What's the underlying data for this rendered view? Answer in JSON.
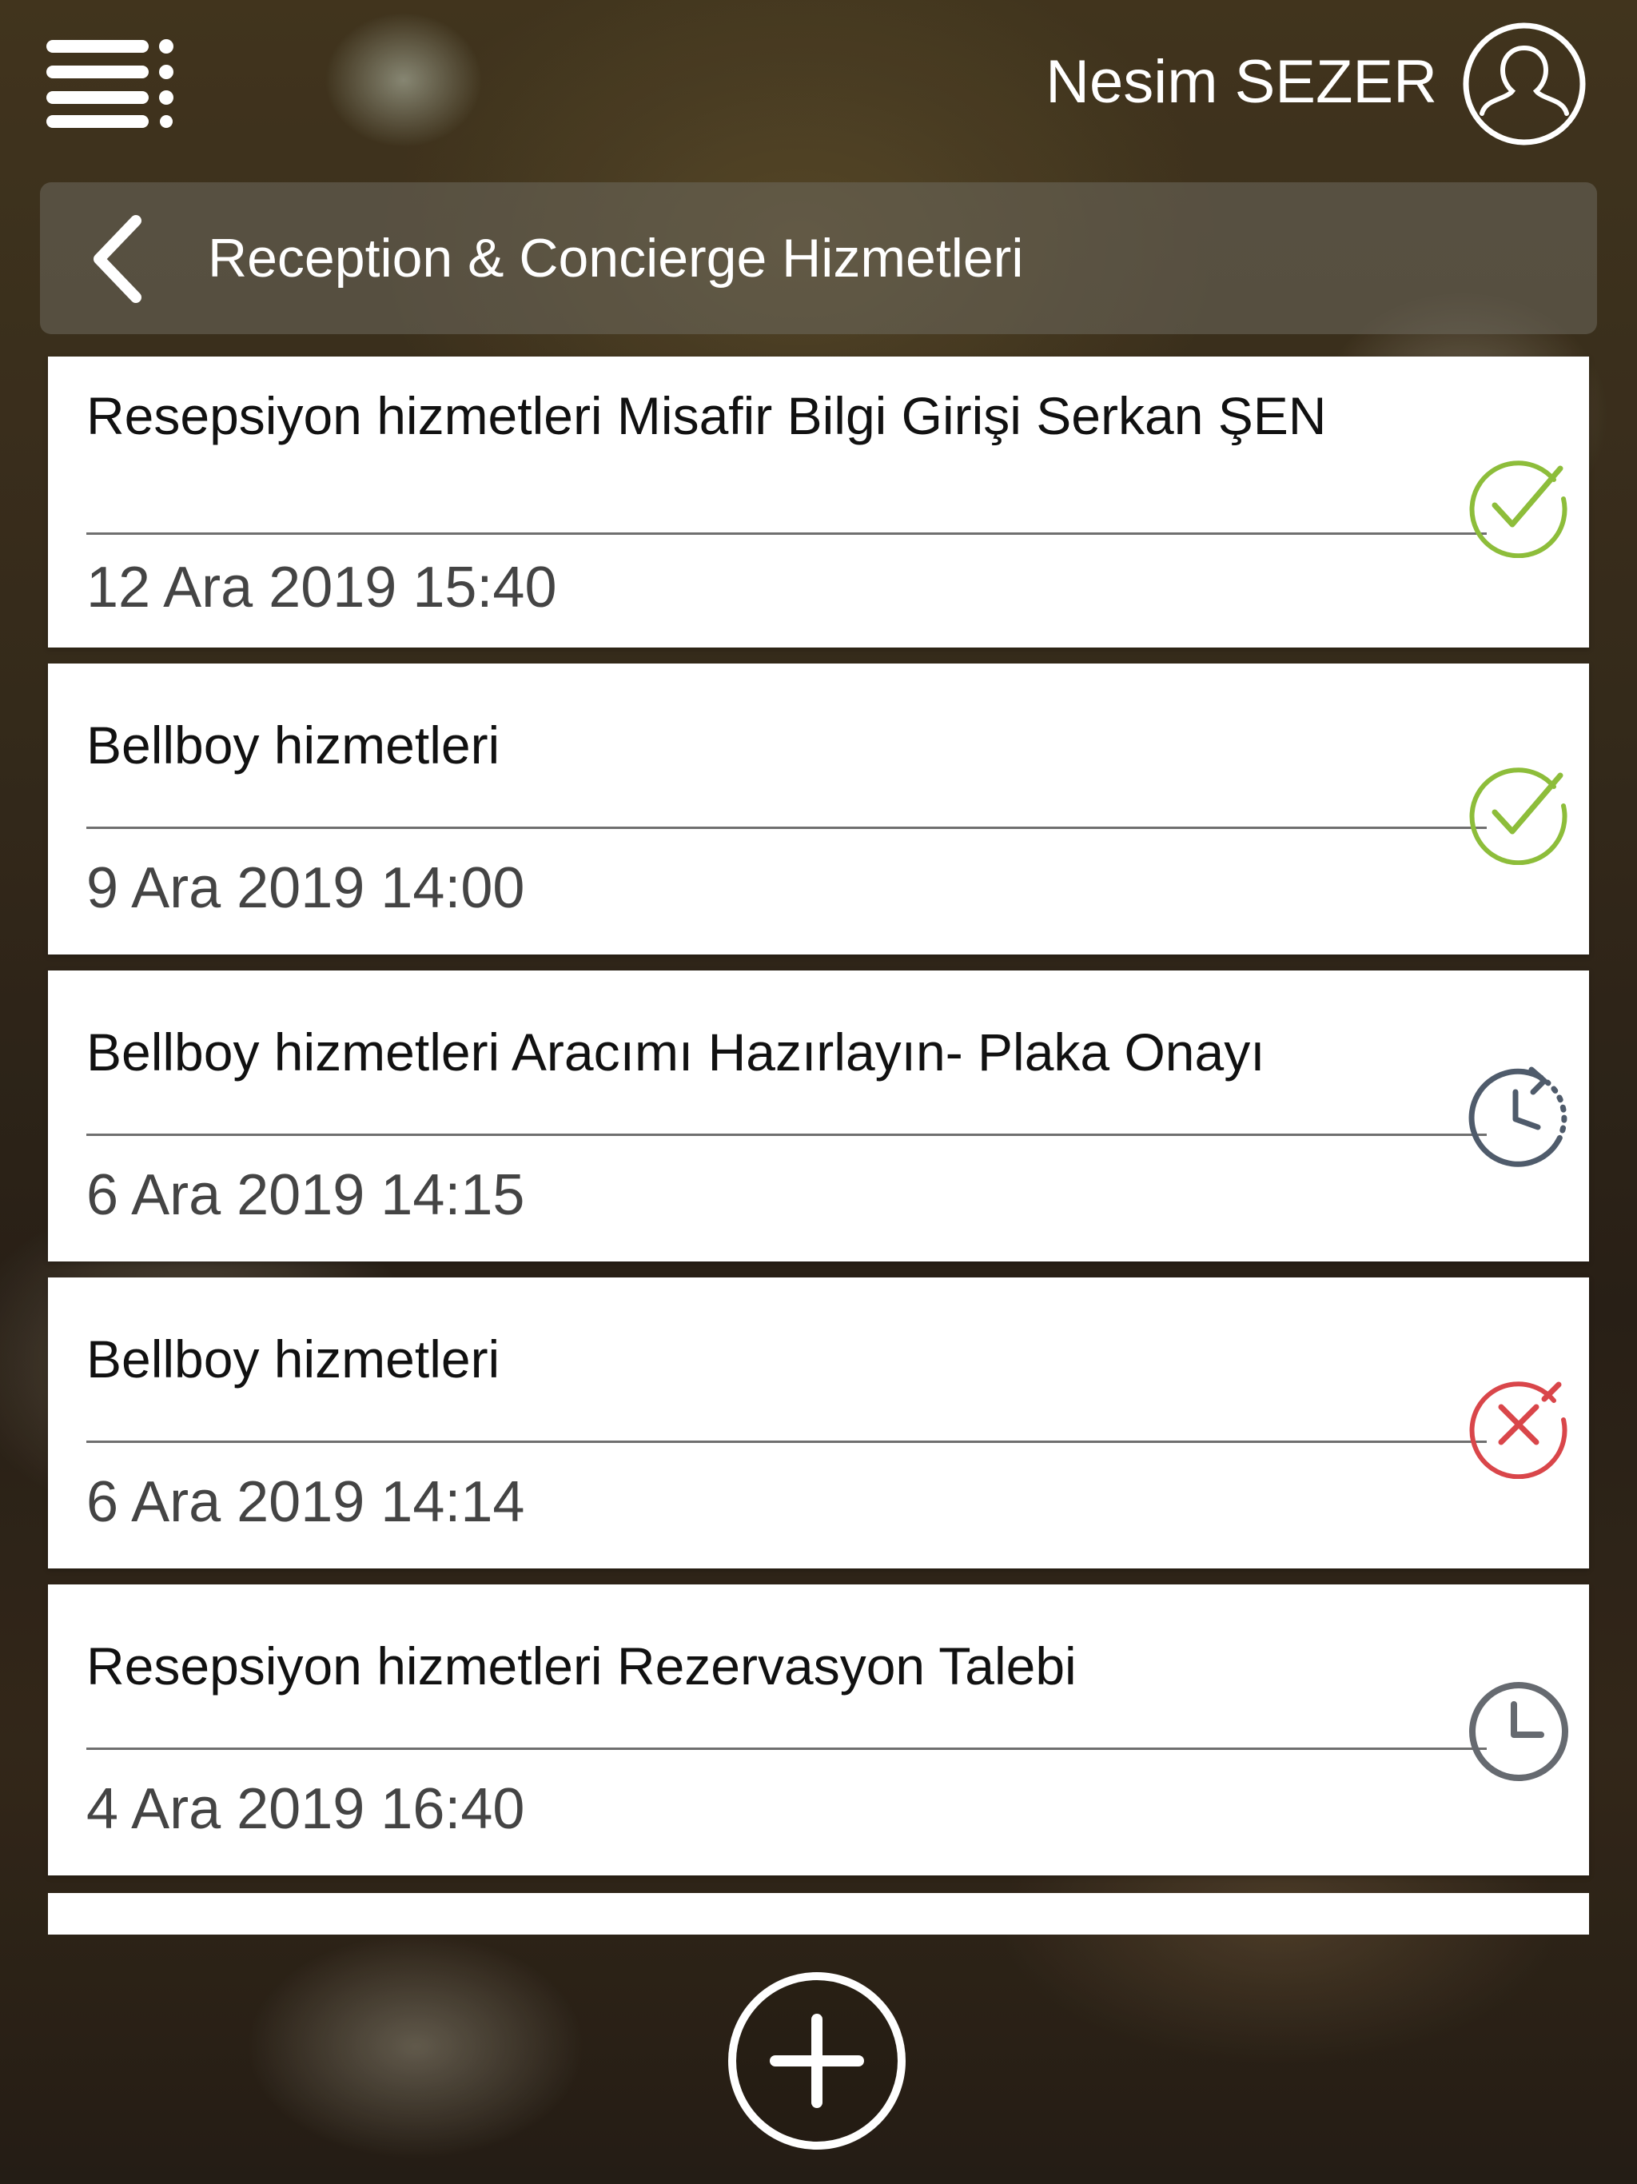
{
  "header": {
    "menu_icon": "menu-icon",
    "user_name": "Nesim SEZER",
    "avatar_icon": "user-icon"
  },
  "title_bar": {
    "back_icon": "chevron-left-icon",
    "title": "Reception & Concierge Hizmetleri"
  },
  "requests": [
    {
      "title": "Resepsiyon hizmetleri Misafir Bilgi Girişi Serkan ŞEN",
      "date": "12 Ara 2019 15:40",
      "status": "completed",
      "status_icon": "check-circle-icon"
    },
    {
      "title": "Bellboy hizmetleri",
      "date": "9 Ara 2019 14:00",
      "status": "completed",
      "status_icon": "check-circle-icon"
    },
    {
      "title": "Bellboy hizmetleri Aracımı Hazırlayın- Plaka Onayı",
      "date": "6 Ara 2019 14:15",
      "status": "in-progress",
      "status_icon": "clock-refresh-icon"
    },
    {
      "title": "Bellboy hizmetleri",
      "date": "6 Ara 2019 14:14",
      "status": "cancelled",
      "status_icon": "x-circle-icon"
    },
    {
      "title": "Resepsiyon hizmetleri Rezervasyon Talebi",
      "date": "4 Ara 2019 16:40",
      "status": "pending",
      "status_icon": "clock-icon"
    }
  ],
  "add_button_icon": "plus-circle-icon",
  "colors": {
    "completed": "#8dbd3a",
    "in_progress": "#4f5b6b",
    "cancelled": "#d9464a",
    "pending": "#666a70"
  }
}
